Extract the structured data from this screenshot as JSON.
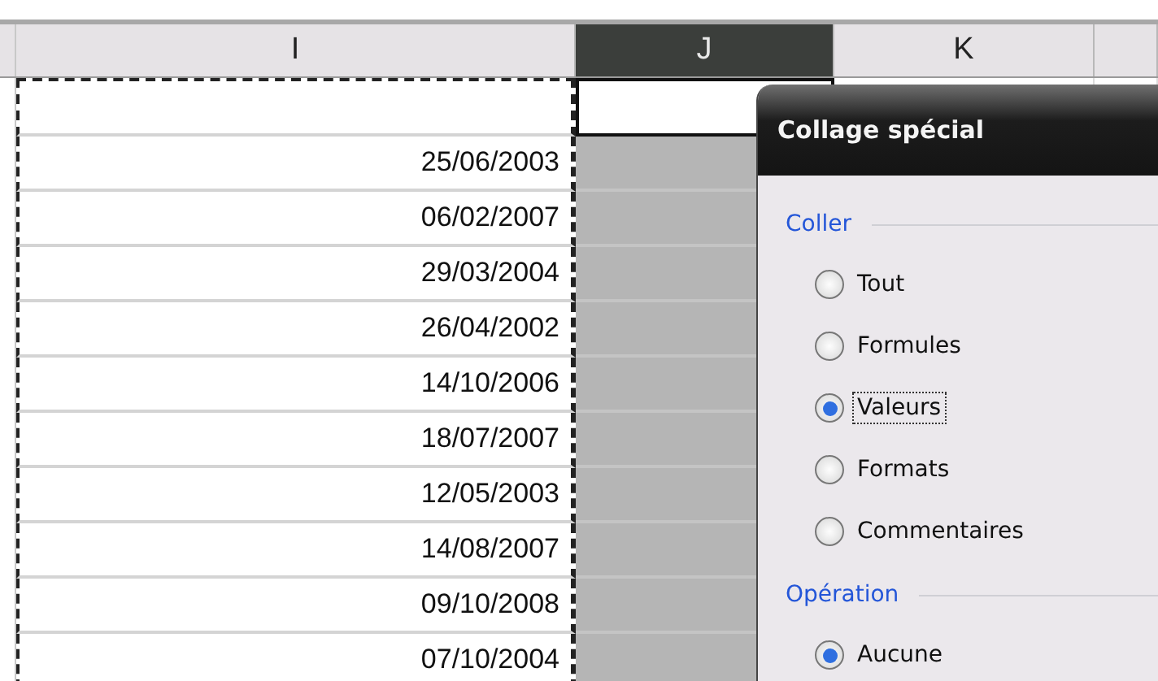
{
  "sheet": {
    "columns": [
      {
        "label": "I",
        "selected": false,
        "copy_marquee": true
      },
      {
        "label": "J",
        "selected": true,
        "copy_marquee": false
      },
      {
        "label": "K",
        "selected": false,
        "copy_marquee": false
      },
      {
        "selected": false,
        "copy_marquee": false
      }
    ],
    "rows": [
      {},
      {
        "value": "25/06/2003"
      },
      {
        "value": "06/02/2007"
      },
      {
        "value": "29/03/2004"
      },
      {
        "value": "26/04/2002"
      },
      {
        "value": "14/10/2006"
      },
      {
        "value": "18/07/2007"
      },
      {
        "value": "12/05/2003"
      },
      {
        "value": "14/08/2007"
      },
      {
        "value": "09/10/2008"
      },
      {
        "value": "07/10/2004"
      }
    ]
  },
  "dialog": {
    "title": "Collage spécial",
    "groups": [
      {
        "label": "Coller",
        "options": [
          {
            "label": "Tout",
            "selected": false,
            "focused": false
          },
          {
            "label": "Formules",
            "selected": false,
            "focused": false
          },
          {
            "label": "Valeurs",
            "selected": true,
            "focused": true
          },
          {
            "label": "Formats",
            "selected": false,
            "focused": false
          },
          {
            "label": "Commentaires",
            "selected": false,
            "focused": false
          }
        ]
      },
      {
        "label": "Opération",
        "options": [
          {
            "label": "Aucune",
            "selected": true,
            "focused": false
          }
        ]
      }
    ]
  }
}
